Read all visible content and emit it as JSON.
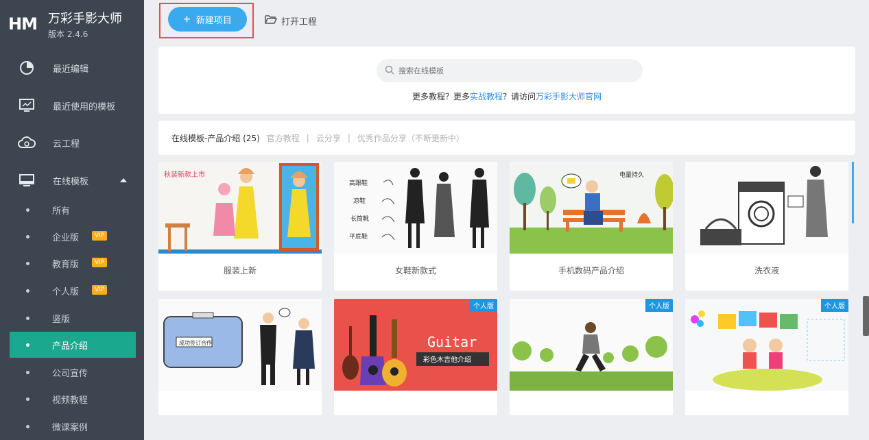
{
  "app": {
    "logo": "HM",
    "name": "万彩手影大师",
    "version": "版本 2.4.6"
  },
  "sidebar": {
    "items": [
      {
        "label": "最近编辑",
        "icon": "pie-chart-icon"
      },
      {
        "label": "最近使用的模板",
        "icon": "monitor-icon"
      },
      {
        "label": "云工程",
        "icon": "cloud-icon"
      },
      {
        "label": "在线模板",
        "icon": "desktop-icon"
      }
    ],
    "sub_items": [
      {
        "label": "所有",
        "vip": ""
      },
      {
        "label": "企业版",
        "vip": "VIP"
      },
      {
        "label": "教育版",
        "vip": "VIP"
      },
      {
        "label": "个人版",
        "vip": "VIP"
      },
      {
        "label": "竖版",
        "vip": ""
      },
      {
        "label": "产品介绍",
        "vip": "",
        "active": true
      },
      {
        "label": "公司宣传",
        "vip": ""
      },
      {
        "label": "视频教程",
        "vip": ""
      },
      {
        "label": "微课案例",
        "vip": ""
      }
    ]
  },
  "toolbar": {
    "new_project": "新建项目",
    "open_project": "打开工程"
  },
  "search": {
    "placeholder": "搜索在线模板",
    "help_prefix": "更多教程？更多",
    "help_link1": "实战教程",
    "help_mid": "？请访问",
    "help_link2": "万彩手影大师官网"
  },
  "category": {
    "current": "在线模板-产品介绍 (25)",
    "links": [
      "官方教程",
      "|",
      "云分享",
      "|",
      "优秀作品分享（不断更新中）"
    ]
  },
  "cards": [
    {
      "title": "服装上新",
      "tag": ""
    },
    {
      "title": "女鞋新款式",
      "tag": ""
    },
    {
      "title": "手机数码产品介绍",
      "tag": ""
    },
    {
      "title": "洗衣液",
      "tag": ""
    },
    {
      "title": "",
      "tag": ""
    },
    {
      "title": "",
      "tag": "个人版"
    },
    {
      "title": "",
      "tag": "个人版"
    },
    {
      "title": "",
      "tag": "个人版"
    }
  ],
  "card_text": {
    "c1_banner": "秋装新款上市",
    "c2_l1": "高跟鞋",
    "c2_l2": "凉鞋",
    "c2_l3": "长筒靴",
    "c2_l4": "平底鞋",
    "c3_bubble": "电量持久",
    "c5_sign": "成功签订合作",
    "c6_big": "Guitar",
    "c6_sub": "彩色木吉他介绍"
  },
  "colors": {
    "sidebar_bg": "#3d4650",
    "active": "#1aa88e",
    "accent": "#3aaaf0",
    "vip": "#f2b020",
    "highlight_outline": "#e05050"
  }
}
